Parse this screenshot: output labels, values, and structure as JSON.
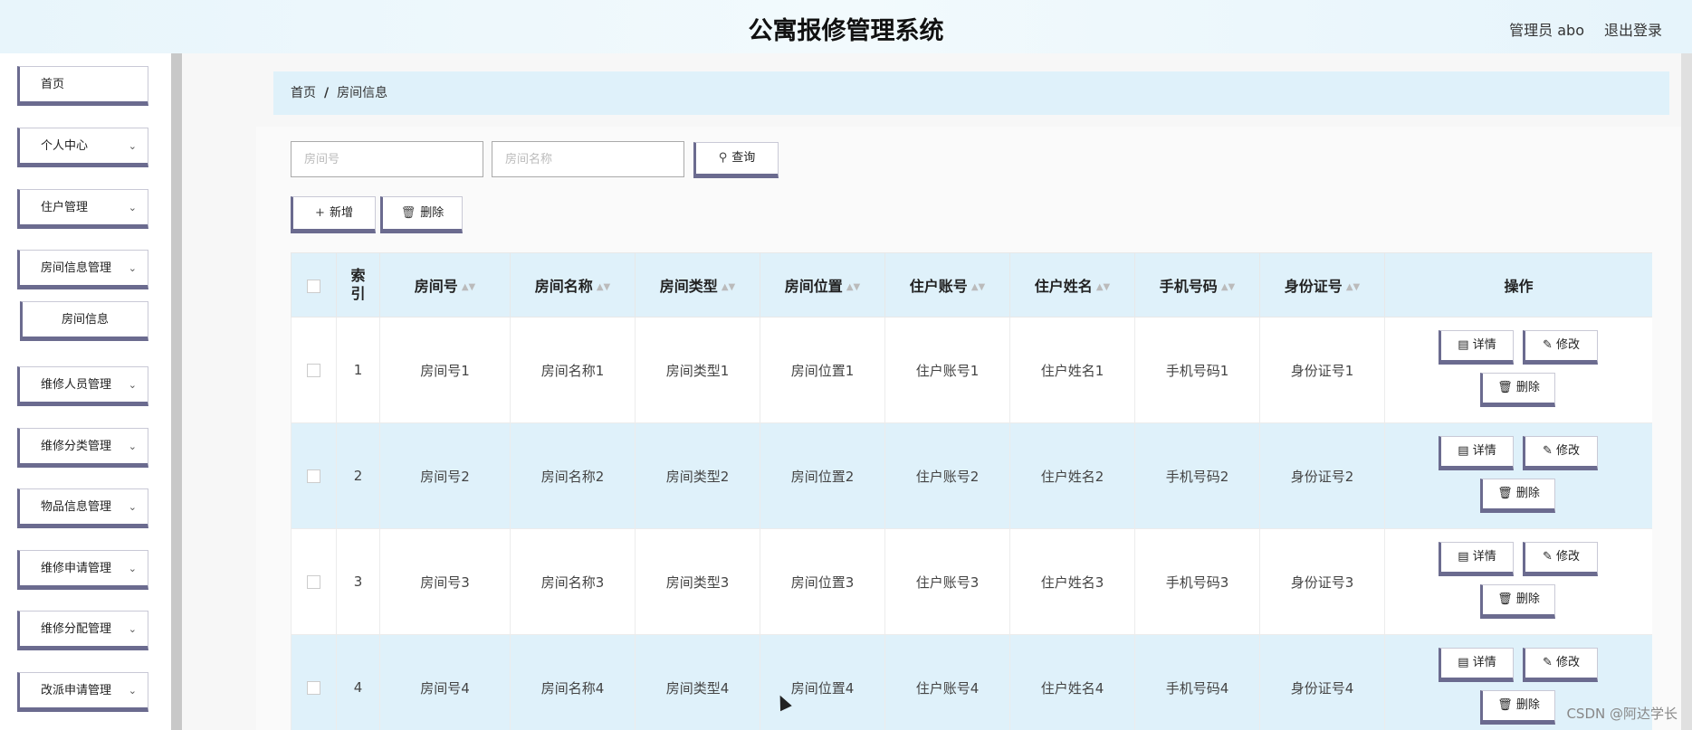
{
  "header": {
    "title": "公寓报修管理系统",
    "user": "管理员 abo",
    "logout": "退出登录"
  },
  "sidebar": {
    "items": [
      {
        "label": "首页",
        "has_children": false
      },
      {
        "label": "个人中心",
        "has_children": true
      },
      {
        "label": "住户管理",
        "has_children": true
      },
      {
        "label": "房间信息管理",
        "has_children": true
      },
      {
        "label": "房间信息",
        "sub": true
      },
      {
        "label": "维修人员管理",
        "has_children": true
      },
      {
        "label": "维修分类管理",
        "has_children": true
      },
      {
        "label": "物品信息管理",
        "has_children": true
      },
      {
        "label": "维修申请管理",
        "has_children": true
      },
      {
        "label": "维修分配管理",
        "has_children": true
      },
      {
        "label": "改派申请管理",
        "has_children": true
      }
    ]
  },
  "breadcrumb": {
    "home": "首页",
    "separator": "/",
    "current": "房间信息"
  },
  "search": {
    "room_no_placeholder": "房间号",
    "room_name_placeholder": "房间名称",
    "query_label": "查询"
  },
  "toolbar": {
    "add_label": "新增",
    "delete_label": "删除"
  },
  "table": {
    "headers": [
      "索引",
      "房间号",
      "房间名称",
      "房间类型",
      "房间位置",
      "住户账号",
      "住户姓名",
      "手机号码",
      "身份证号",
      "操作"
    ],
    "rows": [
      {
        "index": "1",
        "room_no": "房间号1",
        "room_name": "房间名称1",
        "room_type": "房间类型1",
        "room_location": "房间位置1",
        "account": "住户账号1",
        "name": "住户姓名1",
        "phone": "手机号码1",
        "id_no": "身份证号1"
      },
      {
        "index": "2",
        "room_no": "房间号2",
        "room_name": "房间名称2",
        "room_type": "房间类型2",
        "room_location": "房间位置2",
        "account": "住户账号2",
        "name": "住户姓名2",
        "phone": "手机号码2",
        "id_no": "身份证号2"
      },
      {
        "index": "3",
        "room_no": "房间号3",
        "room_name": "房间名称3",
        "room_type": "房间类型3",
        "room_location": "房间位置3",
        "account": "住户账号3",
        "name": "住户姓名3",
        "phone": "手机号码3",
        "id_no": "身份证号3"
      },
      {
        "index": "4",
        "room_no": "房间号4",
        "room_name": "房间名称4",
        "room_type": "房间类型4",
        "room_location": "房间位置4",
        "account": "住户账号4",
        "name": "住户姓名4",
        "phone": "手机号码4",
        "id_no": "身份证号4"
      }
    ],
    "actions": {
      "detail": "详情",
      "edit": "修改",
      "delete": "删除"
    }
  },
  "watermark": "CSDN @阿达学长",
  "colors": {
    "header_bg": "#e8f5fb",
    "accent_border": "#6b6b8f",
    "row_highlight": "#dff1fa"
  }
}
